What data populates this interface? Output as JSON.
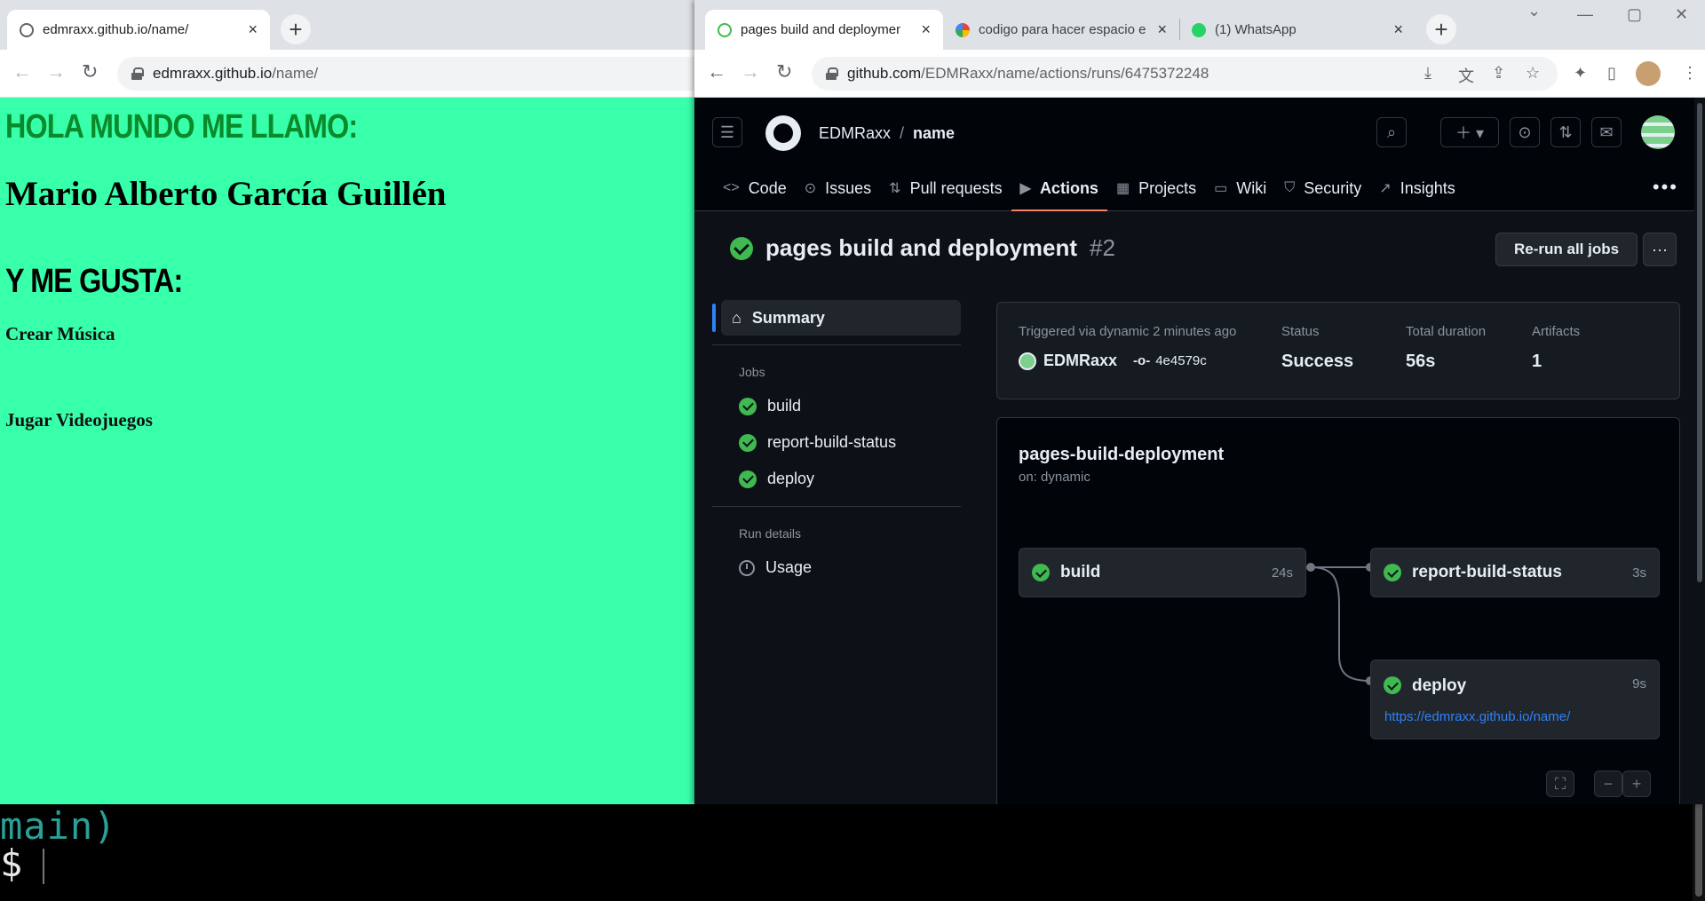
{
  "left_browser": {
    "tab_title": "edmraxx.github.io/name/",
    "url_host": "edmraxx.github.io",
    "url_path": "/name/",
    "page": {
      "heading1": "HOLA MUNDO ME LLAMO:",
      "name": "Mario Alberto García Guillén",
      "heading2": "Y ME GUSTA:",
      "items": [
        "Crear Música",
        "Jugar Videojuegos"
      ]
    }
  },
  "right_browser": {
    "tabs": [
      {
        "title": "pages build and deployment"
      },
      {
        "title": "codigo para hacer espacio e"
      },
      {
        "title": "(1) WhatsApp"
      }
    ],
    "url_host": "github.com",
    "url_path": "/EDMRaxx/name/actions/runs/6475372248",
    "header": {
      "owner": "EDMRaxx",
      "separator": "/",
      "repo": "name"
    },
    "repo_nav": [
      {
        "label": "Code",
        "icon": "code-icon"
      },
      {
        "label": "Issues",
        "icon": "issue-icon"
      },
      {
        "label": "Pull requests",
        "icon": "pull-request-icon"
      },
      {
        "label": "Actions",
        "icon": "play-icon"
      },
      {
        "label": "Projects",
        "icon": "table-icon"
      },
      {
        "label": "Wiki",
        "icon": "book-icon"
      },
      {
        "label": "Security",
        "icon": "shield-icon"
      },
      {
        "label": "Insights",
        "icon": "graph-icon"
      }
    ],
    "run": {
      "title": "pages build and deployment",
      "number": "#2",
      "rerun_label": "Re-run all jobs"
    },
    "sidebar": {
      "summary": "Summary",
      "jobs_label": "Jobs",
      "jobs": [
        "build",
        "report-build-status",
        "deploy"
      ],
      "run_details_label": "Run details",
      "usage": "Usage"
    },
    "meta": {
      "triggered": "Triggered via dynamic 2 minutes ago",
      "actor": "EDMRaxx",
      "commit": "4e4579c",
      "status_label": "Status",
      "status": "Success",
      "duration_label": "Total duration",
      "duration": "56s",
      "artifacts_label": "Artifacts",
      "artifacts": "1"
    },
    "workflow": {
      "name": "pages-build-deployment",
      "trigger": "on: dynamic",
      "nodes": [
        {
          "name": "build",
          "time": "24s"
        },
        {
          "name": "report-build-status",
          "time": "3s"
        },
        {
          "name": "deploy",
          "time": "9s",
          "link": "https://edmraxx.github.io/name/"
        }
      ]
    }
  },
  "terminal": {
    "line1": "main)",
    "prompt": "$"
  },
  "colors": {
    "page_bg": "#37ffaa",
    "heading_green": "#0a8a2a",
    "success": "#3fb950",
    "accent_underline": "#f78166",
    "link": "#2f81f7"
  }
}
